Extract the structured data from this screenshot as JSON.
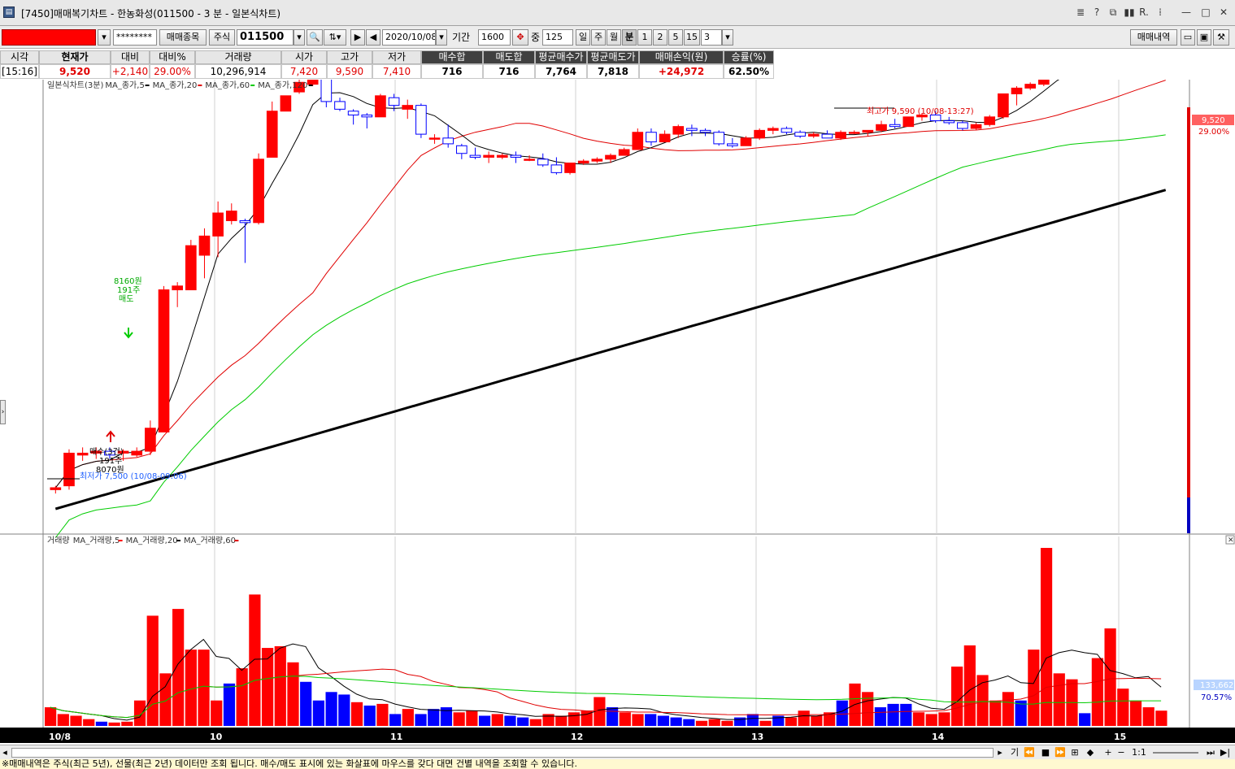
{
  "window": {
    "title": "[7450]매매복기차트 - 한농화성(011500 - 3 분 - 일본식차트)",
    "controls": [
      "≣",
      "?",
      "⧉",
      "▮▮",
      "R.",
      "⁞",
      "—",
      "□",
      "✕"
    ]
  },
  "toolbar": {
    "account_masked": "********",
    "btn_trade_items": "매매종목",
    "market_label": "주식",
    "stock_code": "011500",
    "date": "2020/10/08",
    "period_label": "기간",
    "period_value": "1600",
    "medium_label": "중",
    "count_value": "125",
    "tf_day": "일",
    "tf_week": "주",
    "tf_month": "월",
    "tf_min": "분",
    "tf_1": "1",
    "tf_2": "2",
    "tf_5": "5",
    "tf_15": "15",
    "tf_value": "3",
    "btn_trade_history": "매매내역",
    "folder_icon": "folder-icon",
    "save_icon": "save-icon",
    "wrench_icon": "wrench-icon"
  },
  "quote": {
    "headers": [
      "시각",
      "현재가",
      "대비",
      "대비%",
      "거래량",
      "시가",
      "고가",
      "저가",
      "매수합",
      "매도합",
      "평균매수가",
      "평균매도가",
      "매매손익(원)",
      "승률(%)"
    ],
    "values": [
      "[15:16]",
      "9,520",
      "+2,140",
      "29.00%",
      "10,296,914",
      "7,420",
      "9,590",
      "7,410",
      "716",
      "716",
      "7,764",
      "7,818",
      "+24,972",
      "62.50%"
    ]
  },
  "price_panel": {
    "legend": [
      "일본식차트(3분)",
      "MA_종가,5",
      "MA_종가,20",
      "MA_종가,60",
      "MA_종가,120"
    ],
    "high_annotation": "최고가 9,590 (10/08-13:27)",
    "low_annotation": "최저가 7,500 (10/08-09:06)",
    "buy_marker": [
      "매수(3건)",
      "191주",
      "8070원"
    ],
    "sell_marker": [
      "8160원",
      "191주",
      "매도"
    ],
    "current_price_label": "9,520",
    "current_pct_label": "29.00%"
  },
  "volume_panel": {
    "legend": [
      "거래량",
      "MA_거래량,5",
      "MA_거래량,20",
      "MA_거래량,60"
    ],
    "current_volume_label": "133,662",
    "current_volume_pct": "70.57%",
    "close_icon": "close-icon"
  },
  "x_axis": {
    "labels": [
      "10/8",
      "10",
      "11",
      "12",
      "13",
      "14",
      "15"
    ]
  },
  "bottom": {
    "zoom_label": "1:1",
    "info_text": "※매매내역은 주식(최근 5년), 선물(최근 2년) 데이터만 조회 됩니다. 매수/매도 표시에 있는 화살표에 마우스를 갖다 대면 건별 내역을 조회할 수 있습니다."
  },
  "colors": {
    "up": "#ff0000",
    "down": "#0000ff",
    "ma5": "#000000",
    "ma20": "#e00000",
    "ma60": "#00cc00",
    "ma120": "#000000"
  },
  "chart_data": {
    "type": "candlestick",
    "interval": "3분",
    "price_range": [
      7400,
      9600
    ],
    "candles": [
      [
        7500,
        7520,
        7480,
        7510
      ],
      [
        7520,
        7710,
        7500,
        7690
      ],
      [
        7680,
        7720,
        7650,
        7690
      ],
      [
        7690,
        7720,
        7660,
        7700
      ],
      [
        7700,
        7720,
        7660,
        7680
      ],
      [
        7690,
        7710,
        7650,
        7700
      ],
      [
        7680,
        7720,
        7670,
        7700
      ],
      [
        7700,
        7860,
        7680,
        7820
      ],
      [
        7800,
        8560,
        7800,
        8540
      ],
      [
        8540,
        8580,
        8450,
        8560
      ],
      [
        8540,
        8800,
        8540,
        8770
      ],
      [
        8720,
        8860,
        8600,
        8820
      ],
      [
        8820,
        9000,
        8710,
        8940
      ],
      [
        8900,
        8990,
        8880,
        8950
      ],
      [
        8900,
        8910,
        8680,
        8890
      ],
      [
        8890,
        9250,
        8880,
        9220
      ],
      [
        9230,
        9520,
        9230,
        9470
      ],
      [
        9470,
        9550,
        9470,
        9550
      ],
      [
        9570,
        9650,
        9560,
        9620
      ],
      [
        9610,
        9680,
        9600,
        9660
      ],
      [
        9660,
        9690,
        9490,
        9520
      ],
      [
        9520,
        9540,
        9470,
        9480
      ],
      [
        9470,
        9480,
        9400,
        9450
      ],
      [
        9450,
        9460,
        9380,
        9440
      ],
      [
        9440,
        9560,
        9440,
        9550
      ],
      [
        9540,
        9560,
        9470,
        9500
      ],
      [
        9480,
        9530,
        9430,
        9500
      ],
      [
        9500,
        9510,
        9330,
        9350
      ],
      [
        9330,
        9350,
        9300,
        9330
      ],
      [
        9330,
        9400,
        9280,
        9300
      ],
      [
        9290,
        9300,
        9220,
        9250
      ],
      [
        9240,
        9280,
        9220,
        9230
      ],
      [
        9230,
        9260,
        9200,
        9240
      ],
      [
        9230,
        9250,
        9220,
        9240
      ],
      [
        9240,
        9260,
        9200,
        9230
      ],
      [
        9220,
        9240,
        9210,
        9220
      ],
      [
        9220,
        9250,
        9180,
        9190
      ],
      [
        9190,
        9230,
        9140,
        9150
      ],
      [
        9150,
        9200,
        9140,
        9200
      ],
      [
        9200,
        9220,
        9190,
        9210
      ],
      [
        9210,
        9230,
        9200,
        9220
      ],
      [
        9220,
        9250,
        9200,
        9240
      ],
      [
        9240,
        9280,
        9240,
        9270
      ],
      [
        9270,
        9380,
        9270,
        9360
      ],
      [
        9360,
        9380,
        9290,
        9310
      ],
      [
        9310,
        9370,
        9310,
        9350
      ],
      [
        9350,
        9400,
        9330,
        9390
      ],
      [
        9380,
        9400,
        9340,
        9370
      ],
      [
        9370,
        9380,
        9340,
        9360
      ],
      [
        9360,
        9370,
        9290,
        9300
      ],
      [
        9300,
        9330,
        9280,
        9290
      ],
      [
        9290,
        9340,
        9290,
        9330
      ],
      [
        9330,
        9380,
        9320,
        9370
      ],
      [
        9370,
        9390,
        9350,
        9380
      ],
      [
        9380,
        9390,
        9350,
        9360
      ],
      [
        9360,
        9370,
        9330,
        9340
      ],
      [
        9340,
        9360,
        9330,
        9350
      ],
      [
        9350,
        9370,
        9330,
        9330
      ],
      [
        9330,
        9370,
        9320,
        9360
      ],
      [
        9360,
        9370,
        9350,
        9360
      ],
      [
        9360,
        9370,
        9340,
        9370
      ],
      [
        9370,
        9420,
        9360,
        9400
      ],
      [
        9400,
        9430,
        9380,
        9390
      ],
      [
        9390,
        9440,
        9390,
        9440
      ],
      [
        9440,
        9460,
        9420,
        9450
      ],
      [
        9450,
        9470,
        9410,
        9420
      ],
      [
        9420,
        9440,
        9400,
        9410
      ],
      [
        9410,
        9420,
        9370,
        9380
      ],
      [
        9380,
        9410,
        9370,
        9400
      ],
      [
        9400,
        9450,
        9390,
        9440
      ],
      [
        9440,
        9560,
        9430,
        9560
      ],
      [
        9560,
        9600,
        9500,
        9590
      ],
      [
        9590,
        9620,
        9580,
        9610
      ],
      [
        9610,
        9680,
        9600,
        9670
      ],
      [
        9670,
        9720,
        9660,
        9720
      ],
      [
        9720,
        9780,
        9710,
        9770
      ],
      [
        9770,
        9810,
        9730,
        9740
      ],
      [
        9740,
        9780,
        9730,
        9770
      ],
      [
        9770,
        9820,
        9760,
        9790
      ],
      [
        9790,
        9860,
        9780,
        9860
      ],
      [
        9860,
        9870,
        9860,
        9870
      ],
      [
        9870,
        9880,
        9850,
        9860
      ],
      [
        9860,
        9880,
        9860,
        9880
      ]
    ],
    "volume_values": [
      22,
      14,
      12,
      8,
      5,
      4,
      5,
      30,
      130,
      62,
      138,
      90,
      90,
      30,
      50,
      68,
      155,
      92,
      94,
      75,
      52,
      30,
      40,
      37,
      28,
      24,
      26,
      14,
      20,
      14,
      20,
      22,
      16,
      18,
      12,
      14,
      12,
      10,
      8,
      14,
      12,
      16,
      18,
      34,
      22,
      16,
      14,
      14,
      12,
      10,
      8,
      6,
      8,
      6,
      10,
      14,
      6,
      12,
      10,
      18,
      12,
      16,
      30,
      50,
      40,
      22,
      26,
      26,
      16,
      14,
      16,
      70,
      95,
      60,
      30,
      40,
      30,
      90,
      210,
      62,
      55,
      15,
      80,
      115,
      44,
      30,
      22,
      18
    ]
  }
}
